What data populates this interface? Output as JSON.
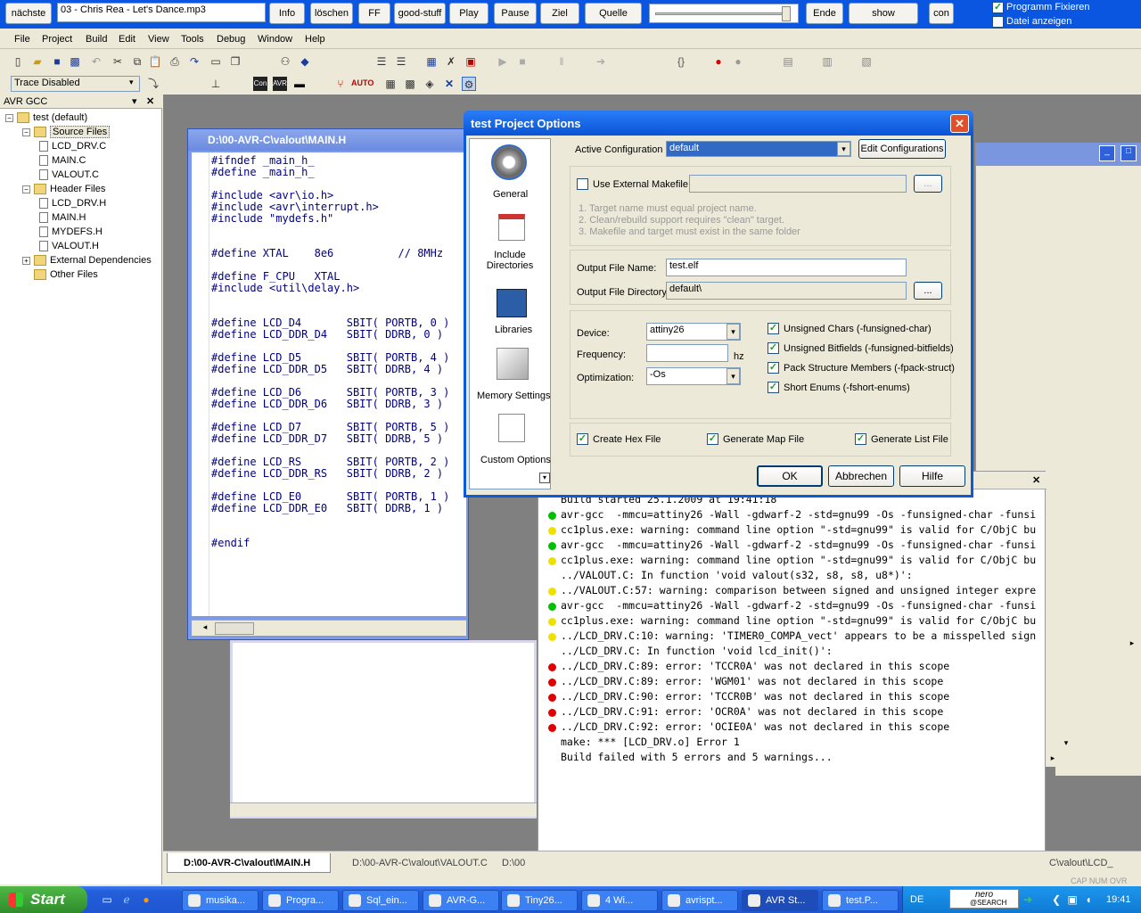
{
  "player": {
    "buttons": [
      "nächste",
      "Info",
      "löschen",
      "FF",
      "good-stuff",
      "Play",
      "Pause",
      "Ziel",
      "Quelle",
      "Ende",
      "show",
      "con"
    ],
    "track": "03 - Chris Rea - Let's Dance.mp3",
    "checkboxes": [
      {
        "label": "Programm Fixieren",
        "checked": true
      },
      {
        "label": "Datei anzeigen",
        "checked": false
      }
    ]
  },
  "menu": [
    "File",
    "Project",
    "Build",
    "Edit",
    "View",
    "Tools",
    "Debug",
    "Window",
    "Help"
  ],
  "toolbar2": {
    "trace": "Trace Disabled",
    "auto": "AUTO"
  },
  "workspace": {
    "title": "AVR GCC",
    "tree": [
      {
        "label": "test (default)",
        "level": 0,
        "type": "project"
      },
      {
        "label": "Source Files",
        "level": 1,
        "type": "folder"
      },
      {
        "label": "LCD_DRV.C",
        "level": 2,
        "type": "file"
      },
      {
        "label": "MAIN.C",
        "level": 2,
        "type": "file"
      },
      {
        "label": "VALOUT.C",
        "level": 2,
        "type": "file"
      },
      {
        "label": "Header Files",
        "level": 1,
        "type": "folder"
      },
      {
        "label": "LCD_DRV.H",
        "level": 2,
        "type": "file"
      },
      {
        "label": "MAIN.H",
        "level": 2,
        "type": "file"
      },
      {
        "label": "MYDEFS.H",
        "level": 2,
        "type": "file"
      },
      {
        "label": "VALOUT.H",
        "level": 2,
        "type": "file"
      },
      {
        "label": "External Dependencies",
        "level": 1,
        "type": "folder"
      },
      {
        "label": "Other Files",
        "level": 1,
        "type": "folder"
      }
    ]
  },
  "editor": {
    "title": "D:\\00-AVR-C\\valout\\MAIN.H",
    "lines": [
      "#ifndef _main_h_",
      "#define _main_h_",
      "",
      "#include <avr\\io.h>",
      "#include <avr\\interrupt.h>",
      "#include \"mydefs.h\"",
      "",
      "",
      "#define XTAL    8e6          // 8MHz",
      "",
      "#define F_CPU   XTAL",
      "#include <util\\delay.h>",
      "",
      "",
      "#define LCD_D4       SBIT( PORTB, 0 )",
      "#define LCD_DDR_D4   SBIT( DDRB, 0 )",
      "",
      "#define LCD_D5       SBIT( PORTB, 4 )",
      "#define LCD_DDR_D5   SBIT( DDRB, 4 )",
      "",
      "#define LCD_D6       SBIT( PORTB, 3 )",
      "#define LCD_DDR_D6   SBIT( DDRB, 3 )",
      "",
      "#define LCD_D7       SBIT( PORTB, 5 )",
      "#define LCD_DDR_D7   SBIT( DDRB, 5 )",
      "",
      "#define LCD_RS       SBIT( PORTB, 2 )",
      "#define LCD_DDR_RS   SBIT( DDRB, 2 )",
      "",
      "#define LCD_E0       SBIT( PORTB, 1 )",
      "#define LCD_DDR_E0   SBIT( DDRB, 1 )",
      "",
      "",
      "#endif"
    ]
  },
  "dialog": {
    "title": "test Project Options",
    "nav": [
      "General",
      "Include Directories",
      "Libraries",
      "Memory Settings",
      "Custom Options"
    ],
    "active_config_label": "Active Configuration",
    "active_config": "default",
    "edit_configs": "Edit Configurations",
    "use_ext_makefile": "Use External Makefile",
    "browse": "...",
    "notes": [
      "1. Target name must equal project name.",
      "2. Clean/rebuild support requires \"clean\" target.",
      "3. Makefile and target must exist in the same folder"
    ],
    "output_file_label": "Output File Name:",
    "output_file": "test.elf",
    "output_dir_label": "Output File Directory:",
    "output_dir": "default\\",
    "device_label": "Device:",
    "device": "attiny26",
    "freq_label": "Frequency:",
    "freq_value": "",
    "freq_unit": "hz",
    "opt_label": "Optimization:",
    "opt": "-Os",
    "flags": [
      "Unsigned Chars (-funsigned-char)",
      "Unsigned Bitfields (-funsigned-bitfields)",
      "Pack Structure Members (-fpack-struct)",
      "Short Enums (-fshort-enums)"
    ],
    "bottom": [
      "Create Hex File",
      "Generate Map File",
      "Generate List File"
    ],
    "ok": "OK",
    "cancel": "Abbrechen",
    "help": "Hilfe"
  },
  "build": {
    "lines": [
      {
        "dot": "none",
        "text": "Build started 25.1.2009 at 19:41:18"
      },
      {
        "dot": "green",
        "text": "avr-gcc  -mmcu=attiny26 -Wall -gdwarf-2 -std=gnu99 -Os -funsigned-char -funsi"
      },
      {
        "dot": "yellow",
        "text": "cc1plus.exe: warning: command line option \"-std=gnu99\" is valid for C/ObjC bu"
      },
      {
        "dot": "green",
        "text": "avr-gcc  -mmcu=attiny26 -Wall -gdwarf-2 -std=gnu99 -Os -funsigned-char -funsi"
      },
      {
        "dot": "yellow",
        "text": "cc1plus.exe: warning: command line option \"-std=gnu99\" is valid for C/ObjC bu"
      },
      {
        "dot": "none",
        "text": "../VALOUT.C: In function 'void valout(s32, s8, s8, u8*)':"
      },
      {
        "dot": "yellow",
        "text": "../VALOUT.C:57: warning: comparison between signed and unsigned integer expre"
      },
      {
        "dot": "green",
        "text": "avr-gcc  -mmcu=attiny26 -Wall -gdwarf-2 -std=gnu99 -Os -funsigned-char -funsi"
      },
      {
        "dot": "yellow",
        "text": "cc1plus.exe: warning: command line option \"-std=gnu99\" is valid for C/ObjC bu"
      },
      {
        "dot": "yellow",
        "text": "../LCD_DRV.C:10: warning: 'TIMER0_COMPA_vect' appears to be a misspelled sign"
      },
      {
        "dot": "none",
        "text": "../LCD_DRV.C: In function 'void lcd_init()':"
      },
      {
        "dot": "red",
        "text": "../LCD_DRV.C:89: error: 'TCCR0A' was not declared in this scope"
      },
      {
        "dot": "red",
        "text": "../LCD_DRV.C:89: error: 'WGM01' was not declared in this scope"
      },
      {
        "dot": "red",
        "text": "../LCD_DRV.C:90: error: 'TCCR0B' was not declared in this scope"
      },
      {
        "dot": "red",
        "text": "../LCD_DRV.C:91: error: 'OCR0A' was not declared in this scope"
      },
      {
        "dot": "red",
        "text": "../LCD_DRV.C:92: error: 'OCIE0A' was not declared in this scope"
      },
      {
        "dot": "none",
        "text": "make: *** [LCD_DRV.o] Error 1"
      },
      {
        "dot": "none",
        "text": "Build failed with 5 errors and 5 warnings..."
      }
    ]
  },
  "doc_tabs": [
    "D:\\00-AVR-C\\valout\\MAIN.H",
    "D:\\00-AVR-C\\valout\\VALOUT.C",
    "D:\\00",
    "C\\valout\\LCD_"
  ],
  "taskbar": {
    "start": "Start",
    "items": [
      "musika...",
      "Progra...",
      "Sql_ein...",
      "AVR-G...",
      "Tiny26...",
      "4 Wi...",
      "avrispt...",
      "AVR St...",
      "test.P..."
    ],
    "lang": "DE",
    "nero": "nero",
    "nero2": "@SEARCH",
    "clock": "19:41",
    "kbd": "CAP  NUM  OVR"
  },
  "colors": {
    "titlebar": "#0a5bd8",
    "taskbar": "#245edb",
    "start": "#3c9a32",
    "selection": "#316ac5",
    "code": "#000080"
  }
}
